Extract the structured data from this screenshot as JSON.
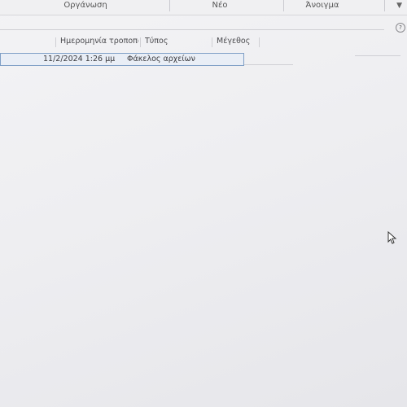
{
  "ribbon": {
    "groups": [
      {
        "label": "Οργάνωση"
      },
      {
        "label": "Νέο"
      },
      {
        "label": "Άνοιγμα"
      }
    ]
  },
  "file_list": {
    "columns": [
      {
        "label": "Ημερομηνία τροποποί..."
      },
      {
        "label": "Τύπος"
      },
      {
        "label": "Μέγεθος"
      }
    ],
    "rows": [
      {
        "date": "11/2/2024 1:26 μμ",
        "type": "Φάκελος αρχείων",
        "size": ""
      }
    ]
  },
  "icons": {
    "help": "help-icon",
    "caret": "chevron-down-icon",
    "cursor": "mouse-pointer-icon"
  }
}
